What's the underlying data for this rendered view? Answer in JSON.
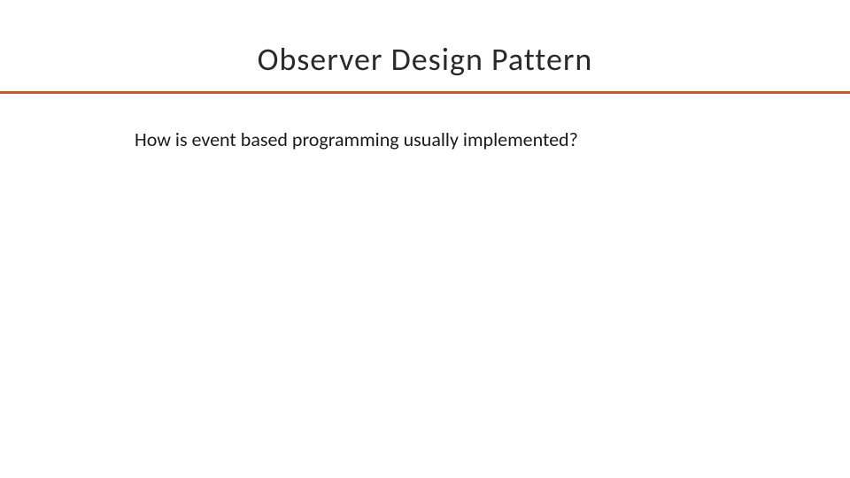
{
  "slide": {
    "title": "Observer Design Pattern",
    "body": "How is event based programming usually implemented?"
  },
  "colors": {
    "accent": "#c55a2b",
    "text": "#1a1a1a"
  }
}
